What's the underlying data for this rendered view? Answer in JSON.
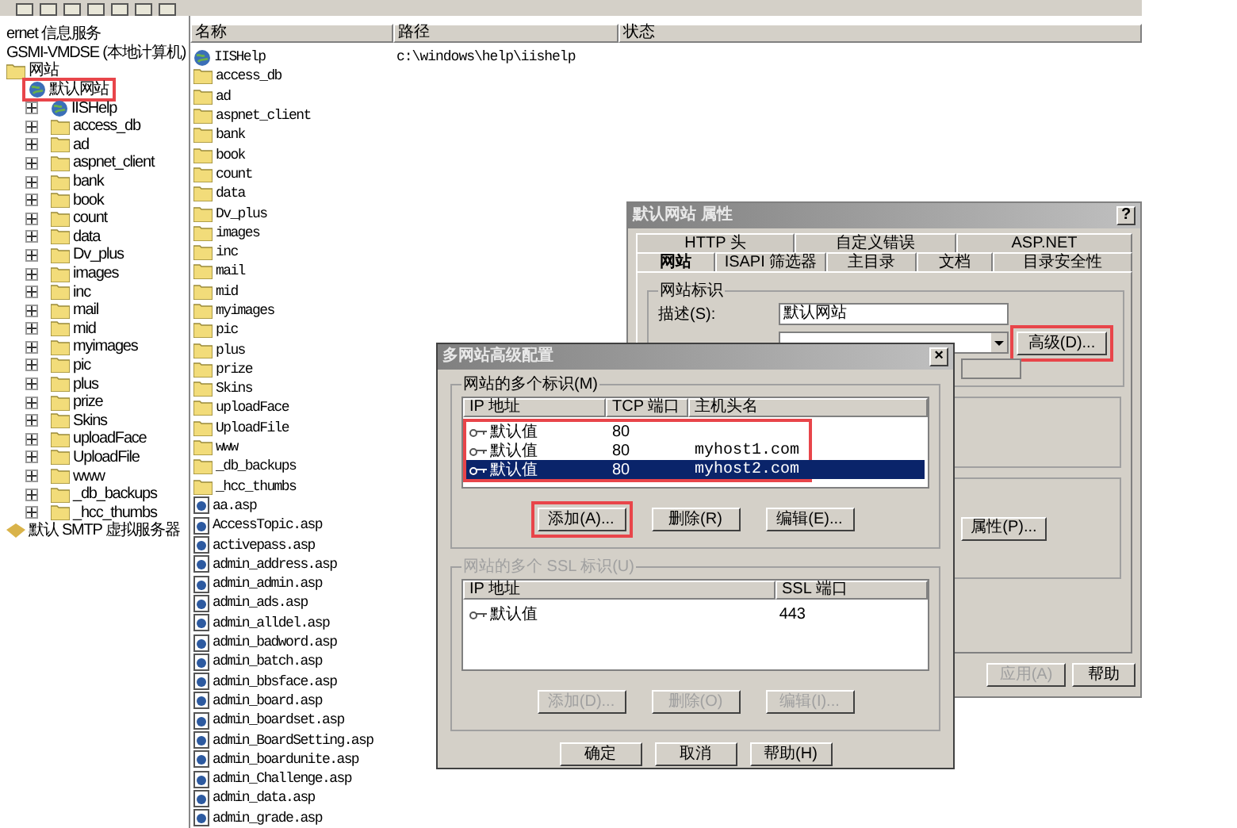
{
  "tree": {
    "items": [
      {
        "label": "ernet 信息服务",
        "children": [
          {
            "label": "GSMI-VMDSE (本地计算机)",
            "children": [
              {
                "label": "网站",
                "kind": "folder-open",
                "children": [
                  {
                    "label": "默认网站",
                    "kind": "site",
                    "annotated": true,
                    "children": [
                      {
                        "label": "IISHelp",
                        "kind": "globe",
                        "expandable": true
                      },
                      {
                        "label": "access_db",
                        "kind": "folder",
                        "expandable": true
                      },
                      {
                        "label": "ad",
                        "kind": "folder",
                        "expandable": true
                      },
                      {
                        "label": "aspnet_client",
                        "kind": "folder",
                        "expandable": true
                      },
                      {
                        "label": "bank",
                        "kind": "folder",
                        "expandable": true
                      },
                      {
                        "label": "book",
                        "kind": "folder",
                        "expandable": true
                      },
                      {
                        "label": "count",
                        "kind": "folder",
                        "expandable": true
                      },
                      {
                        "label": "data",
                        "kind": "folder",
                        "expandable": true
                      },
                      {
                        "label": "Dv_plus",
                        "kind": "folder",
                        "expandable": true
                      },
                      {
                        "label": "images",
                        "kind": "folder",
                        "expandable": true
                      },
                      {
                        "label": "inc",
                        "kind": "folder",
                        "expandable": true
                      },
                      {
                        "label": "mail",
                        "kind": "folder",
                        "expandable": true
                      },
                      {
                        "label": "mid",
                        "kind": "folder",
                        "expandable": true
                      },
                      {
                        "label": "myimages",
                        "kind": "folder",
                        "expandable": true
                      },
                      {
                        "label": "pic",
                        "kind": "folder",
                        "expandable": true
                      },
                      {
                        "label": "plus",
                        "kind": "folder",
                        "expandable": true
                      },
                      {
                        "label": "prize",
                        "kind": "folder",
                        "expandable": true
                      },
                      {
                        "label": "Skins",
                        "kind": "folder",
                        "expandable": true
                      },
                      {
                        "label": "uploadFace",
                        "kind": "folder",
                        "expandable": true
                      },
                      {
                        "label": "UploadFile",
                        "kind": "folder",
                        "expandable": true
                      },
                      {
                        "label": "www",
                        "kind": "folder",
                        "expandable": true
                      },
                      {
                        "label": "_db_backups",
                        "kind": "folder",
                        "expandable": true
                      },
                      {
                        "label": "_hcc_thumbs",
                        "kind": "folder",
                        "expandable": true
                      }
                    ]
                  }
                ]
              },
              {
                "label": "默认 SMTP 虚拟服务器",
                "kind": "mail-server"
              }
            ]
          }
        ]
      }
    ]
  },
  "list": {
    "columns": [
      "名称",
      "路径",
      "状态"
    ],
    "rows": [
      {
        "name": "IISHelp",
        "kind": "globe",
        "path": "c:\\windows\\help\\iishelp"
      },
      {
        "name": "access_db",
        "kind": "folder"
      },
      {
        "name": "ad",
        "kind": "folder"
      },
      {
        "name": "aspnet_client",
        "kind": "folder"
      },
      {
        "name": "bank",
        "kind": "folder"
      },
      {
        "name": "book",
        "kind": "folder"
      },
      {
        "name": "count",
        "kind": "folder"
      },
      {
        "name": "data",
        "kind": "folder"
      },
      {
        "name": "Dv_plus",
        "kind": "folder"
      },
      {
        "name": "images",
        "kind": "folder"
      },
      {
        "name": "inc",
        "kind": "folder"
      },
      {
        "name": "mail",
        "kind": "folder"
      },
      {
        "name": "mid",
        "kind": "folder"
      },
      {
        "name": "myimages",
        "kind": "folder"
      },
      {
        "name": "pic",
        "kind": "folder"
      },
      {
        "name": "plus",
        "kind": "folder"
      },
      {
        "name": "prize",
        "kind": "folder"
      },
      {
        "name": "Skins",
        "kind": "folder"
      },
      {
        "name": "uploadFace",
        "kind": "folder"
      },
      {
        "name": "UploadFile",
        "kind": "folder"
      },
      {
        "name": "www",
        "kind": "folder"
      },
      {
        "name": "_db_backups",
        "kind": "folder"
      },
      {
        "name": "_hcc_thumbs",
        "kind": "folder"
      },
      {
        "name": "aa.asp",
        "kind": "file"
      },
      {
        "name": "AccessTopic.asp",
        "kind": "file"
      },
      {
        "name": "activepass.asp",
        "kind": "file"
      },
      {
        "name": "admin_address.asp",
        "kind": "file"
      },
      {
        "name": "admin_admin.asp",
        "kind": "file"
      },
      {
        "name": "admin_ads.asp",
        "kind": "file"
      },
      {
        "name": "admin_alldel.asp",
        "kind": "file"
      },
      {
        "name": "admin_badword.asp",
        "kind": "file"
      },
      {
        "name": "admin_batch.asp",
        "kind": "file"
      },
      {
        "name": "admin_bbsface.asp",
        "kind": "file"
      },
      {
        "name": "admin_board.asp",
        "kind": "file"
      },
      {
        "name": "admin_boardset.asp",
        "kind": "file"
      },
      {
        "name": "admin_BoardSetting.asp",
        "kind": "file"
      },
      {
        "name": "admin_boardunite.asp",
        "kind": "file"
      },
      {
        "name": "admin_Challenge.asp",
        "kind": "file"
      },
      {
        "name": "admin_data.asp",
        "kind": "file"
      },
      {
        "name": "admin_grade.asp",
        "kind": "file"
      }
    ]
  },
  "properties_dialog": {
    "title": "默认网站 属性",
    "help": "?",
    "tab_rows": [
      [
        {
          "label": "HTTP 头",
          "selected": false
        },
        {
          "label": "自定义错误",
          "selected": false
        },
        {
          "label": "ASP.NET",
          "selected": false
        }
      ],
      [
        {
          "label": "网站",
          "selected": true
        },
        {
          "label": "ISAPI 筛选器",
          "selected": false
        },
        {
          "label": "主目录",
          "selected": false
        },
        {
          "label": "文档",
          "selected": false
        },
        {
          "label": "目录安全性",
          "selected": false
        }
      ]
    ],
    "group": "网站标识",
    "description": {
      "label": "描述(S):",
      "value": "默认网站"
    },
    "advanced_button": {
      "label": "高级(D)...",
      "annotated": true
    },
    "properties_button": "属性(P)...",
    "buttons": [
      {
        "label": "应用(A)",
        "disabled": true
      },
      {
        "label": "帮助",
        "disabled": false
      }
    ]
  },
  "advanced_dialog": {
    "title": "多网站高级配置",
    "close": "×",
    "identities": {
      "label": "网站的多个标识(M)",
      "disabled": false,
      "columns": [
        "IP 地址",
        "TCP 端口",
        "主机头名"
      ],
      "annotated": true,
      "rows": [
        {
          "cells": [
            "默认值",
            "80",
            ""
          ],
          "selected": false
        },
        {
          "cells": [
            "默认值",
            "80",
            "myhost1.com"
          ],
          "selected": false
        },
        {
          "cells": [
            "默认值",
            "80",
            "myhost2.com"
          ],
          "selected": true
        }
      ],
      "buttons": [
        {
          "label": "添加(A)...",
          "disabled": false,
          "annotated": true
        },
        {
          "label": "删除(R)",
          "disabled": false,
          "annotated": false
        },
        {
          "label": "编辑(E)...",
          "disabled": false,
          "annotated": false
        }
      ]
    },
    "ssl": {
      "label": "网站的多个 SSL 标识(U)",
      "disabled": true,
      "columns": [
        "IP 地址",
        "SSL 端口"
      ],
      "rows": [
        {
          "cells": [
            "默认值",
            "443"
          ],
          "selected": false
        }
      ],
      "buttons": [
        {
          "label": "添加(D)...",
          "disabled": true,
          "annotated": false
        },
        {
          "label": "删除(O)",
          "disabled": true,
          "annotated": false
        },
        {
          "label": "编辑(I)...",
          "disabled": true,
          "annotated": false
        }
      ]
    },
    "buttons": [
      "确定",
      "取消",
      "帮助(H)"
    ]
  }
}
